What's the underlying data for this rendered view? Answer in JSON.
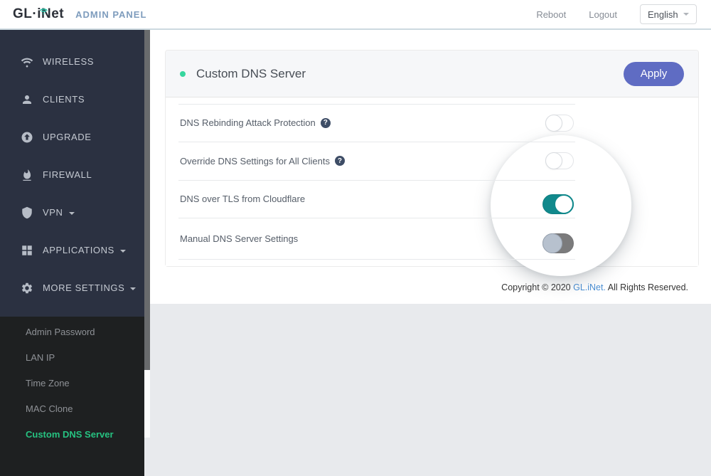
{
  "header": {
    "brand": "GL·iNet",
    "admin_panel": "ADMIN PANEL",
    "reboot": "Reboot",
    "logout": "Logout",
    "language": "English"
  },
  "sidebar": {
    "items": [
      {
        "label": "WIRELESS",
        "icon": "wifi-icon"
      },
      {
        "label": "CLIENTS",
        "icon": "person-icon"
      },
      {
        "label": "UPGRADE",
        "icon": "arrow-up-circle-icon"
      },
      {
        "label": "FIREWALL",
        "icon": "flame-icon"
      },
      {
        "label": "VPN",
        "icon": "shield-icon",
        "expandable": true
      },
      {
        "label": "APPLICATIONS",
        "icon": "grid-icon",
        "expandable": true
      },
      {
        "label": "MORE SETTINGS",
        "icon": "gear-icon",
        "expandable": true
      }
    ],
    "submenu": [
      {
        "label": "Admin Password",
        "active": false
      },
      {
        "label": "LAN IP",
        "active": false
      },
      {
        "label": "Time Zone",
        "active": false
      },
      {
        "label": "MAC Clone",
        "active": false
      },
      {
        "label": "Custom DNS Server",
        "active": true
      }
    ]
  },
  "card": {
    "title": "Custom DNS Server",
    "apply_label": "Apply",
    "help_glyph": "?",
    "rows": [
      {
        "label": "DNS Rebinding Attack Protection",
        "has_help": true,
        "toggle_state": "off"
      },
      {
        "label": "Override DNS Settings for All Clients",
        "has_help": true,
        "toggle_state": "off"
      },
      {
        "label": "DNS over TLS from Cloudflare",
        "has_help": false,
        "toggle_state": "on"
      },
      {
        "label": "Manual DNS Server Settings",
        "has_help": false,
        "toggle_state": "gray"
      }
    ]
  },
  "footer": {
    "copyright_prefix": "Copyright © 2020 ",
    "copyright_link": "GL.iNet.",
    "copyright_suffix": " All Rights Reserved."
  },
  "colors": {
    "accent_teal": "#11898c",
    "active_green": "#26c281",
    "apply_indigo": "#5f6cc3",
    "status_dot_mint": "#36d69e",
    "sidebar_navy": "#2b3141",
    "submenu_dark": "#1e2021"
  }
}
